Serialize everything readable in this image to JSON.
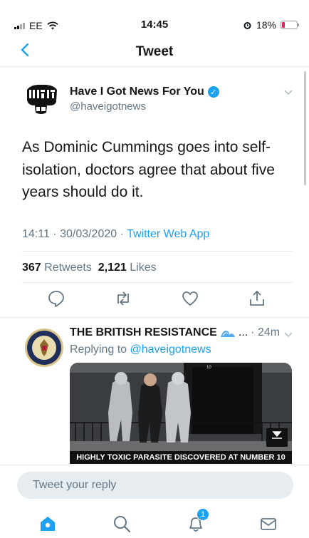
{
  "status_bar": {
    "carrier": "EE",
    "time": "14:45",
    "battery_percent": "18%",
    "battery_level": 0.18
  },
  "header": {
    "title": "Tweet"
  },
  "tweet": {
    "author_name": "Have I Got News For You",
    "author_handle": "@haveigotnews",
    "verified": true,
    "text": "As Dominic Cummings goes into self-isolation, doctors agree that about five years should do it.",
    "timestamp": "14:11 · 30/03/2020 · ",
    "source": "Twitter Web App",
    "retweets_count": "367",
    "retweets_label": "Retweets",
    "likes_count": "2,121",
    "likes_label": "Likes"
  },
  "reply": {
    "author_name": "THE BRITISH RESISTANCE",
    "ellipsis": "...",
    "time": "· 24m",
    "replying_prefix": "Replying to",
    "replying_to": "@haveigotnews",
    "media_caption": "HIGHLY TOXIC PARASITE DISCOVERED AT NUMBER 10",
    "door_number": "10"
  },
  "composer": {
    "placeholder": "Tweet your reply"
  },
  "tabbar": {
    "notification_count": "1"
  },
  "colors": {
    "accent": "#1da1f2",
    "text": "#14171a",
    "secondary": "#657786",
    "battery_low": "#e0245e"
  },
  "icons": {
    "home": "home-icon",
    "search": "search-icon",
    "notifications": "bell-icon",
    "messages": "mail-icon"
  }
}
